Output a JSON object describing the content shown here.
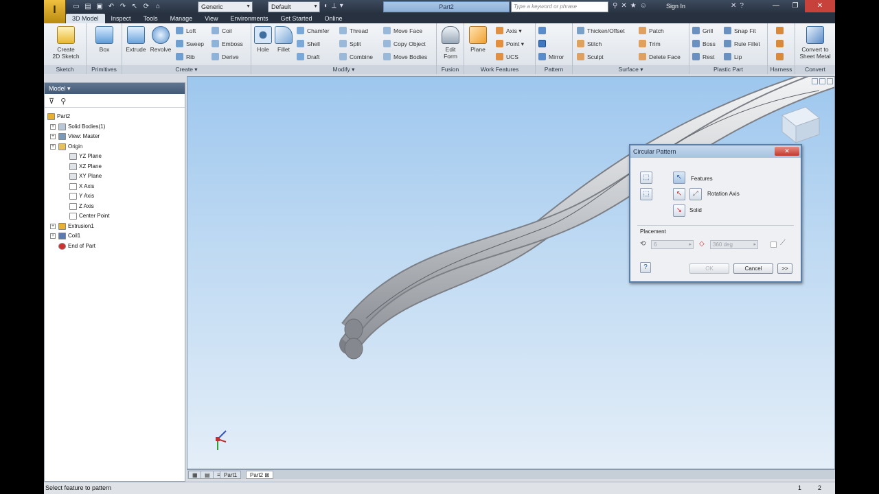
{
  "window": {
    "document_title": "Part2",
    "app_logo": "I",
    "material_combo": "Generic",
    "appearance_combo": "Default",
    "search_placeholder": "Type a keyword or phrase",
    "sign_in": "Sign In"
  },
  "tabs": [
    "3D Model",
    "Inspect",
    "Tools",
    "Manage",
    "View",
    "Environments",
    "Get Started",
    "Online"
  ],
  "active_tab": "3D Model",
  "ribbon": {
    "sketch": {
      "label": "Sketch",
      "create_2d_sketch": "Create\n2D Sketch"
    },
    "primitives": {
      "label": "Primitives",
      "box": "Box"
    },
    "create": {
      "label": "Create",
      "extrude": "Extrude",
      "revolve": "Revolve",
      "loft": "Loft",
      "sweep": "Sweep",
      "rib": "Rib",
      "coil": "Coil",
      "emboss": "Emboss",
      "derive": "Derive"
    },
    "modify": {
      "label": "Modify",
      "hole": "Hole",
      "fillet": "Fillet",
      "chamfer": "Chamfer",
      "shell": "Shell",
      "draft": "Draft",
      "thread": "Thread",
      "split": "Split",
      "combine": "Combine",
      "move_face": "Move Face",
      "copy_object": "Copy Object",
      "move_bodies": "Move Bodies"
    },
    "fusion": {
      "label": "Fusion",
      "edit_form": "Edit\nForm"
    },
    "work_features": {
      "label": "Work Features",
      "plane": "Plane",
      "axis": "Axis",
      "point": "Point",
      "ucs": "UCS"
    },
    "pattern": {
      "label": "Pattern",
      "mirror": "Mirror"
    },
    "surface": {
      "label": "Surface",
      "thicken_offset": "Thicken/Offset",
      "stitch": "Stitch",
      "sculpt": "Sculpt",
      "patch": "Patch",
      "trim": "Trim",
      "delete_face": "Delete Face"
    },
    "plastic_part": {
      "label": "Plastic Part",
      "grill": "Grill",
      "boss": "Boss",
      "rest": "Rest",
      "snap_fit": "Snap Fit",
      "rule_fillet": "Rule Fillet",
      "lip": "Lip"
    },
    "harness": {
      "label": "Harness"
    },
    "convert": {
      "label": "Convert",
      "convert_to_sheet_metal": "Convert to\nSheet Metal"
    }
  },
  "browser": {
    "title": "Model",
    "tree": [
      {
        "label": "Part2",
        "level": 0,
        "icon": "part-icon"
      },
      {
        "label": "Solid Bodies(1)",
        "level": 1,
        "icon": "solid-bodies-icon"
      },
      {
        "label": "View: Master",
        "level": 1,
        "icon": "view-icon"
      },
      {
        "label": "Origin",
        "level": 1,
        "icon": "folder-icon"
      },
      {
        "label": "YZ Plane",
        "level": 2,
        "icon": "plane-icon"
      },
      {
        "label": "XZ Plane",
        "level": 2,
        "icon": "plane-icon"
      },
      {
        "label": "XY Plane",
        "level": 2,
        "icon": "plane-icon"
      },
      {
        "label": "X Axis",
        "level": 2,
        "icon": "axis-icon"
      },
      {
        "label": "Y Axis",
        "level": 2,
        "icon": "axis-icon"
      },
      {
        "label": "Z Axis",
        "level": 2,
        "icon": "axis-icon"
      },
      {
        "label": "Center Point",
        "level": 2,
        "icon": "point-icon"
      },
      {
        "label": "Extrusion1",
        "level": 1,
        "icon": "extrusion-icon"
      },
      {
        "label": "Coil1",
        "level": 1,
        "icon": "coil-icon"
      },
      {
        "label": "End of Part",
        "level": 1,
        "icon": "end-of-part-icon"
      }
    ]
  },
  "dialog": {
    "title": "Circular Pattern",
    "features_label": "Features",
    "rotation_axis_label": "Rotation Axis",
    "solid_label": "Solid",
    "placement_label": "Placement",
    "count_value": "6",
    "angle_value": "360 deg",
    "ok": "OK",
    "cancel": "Cancel",
    "more": ">>"
  },
  "document_tabs": [
    "Part1",
    "Part2"
  ],
  "active_document": "Part2",
  "status": {
    "message": "Select feature to pattern",
    "count_a": "1",
    "count_b": "2"
  },
  "colors": {
    "accent": "#4a7fb5",
    "viewport_top": "#9ec7ee",
    "viewport_bottom": "#e4eef8"
  }
}
